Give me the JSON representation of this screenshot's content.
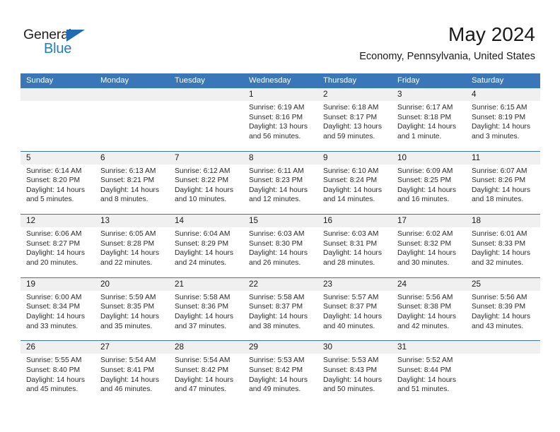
{
  "logo": {
    "word1": "General",
    "word2": "Blue",
    "triangle_color": "#1f6bb4",
    "word2_color": "#1f7ec4"
  },
  "header": {
    "title": "May 2024",
    "subtitle": "Economy, Pennsylvania, United States"
  },
  "theme": {
    "header_bar_color": "#3a77b8",
    "daynum_band_color": "#f0f0f0",
    "text_color": "#1a1a1a"
  },
  "weekdays": [
    "Sunday",
    "Monday",
    "Tuesday",
    "Wednesday",
    "Thursday",
    "Friday",
    "Saturday"
  ],
  "weeks": [
    [
      {
        "day": "",
        "lines": []
      },
      {
        "day": "",
        "lines": []
      },
      {
        "day": "",
        "lines": []
      },
      {
        "day": "1",
        "lines": [
          "Sunrise: 6:19 AM",
          "Sunset: 8:16 PM",
          "Daylight: 13 hours",
          "and 56 minutes."
        ]
      },
      {
        "day": "2",
        "lines": [
          "Sunrise: 6:18 AM",
          "Sunset: 8:17 PM",
          "Daylight: 13 hours",
          "and 59 minutes."
        ]
      },
      {
        "day": "3",
        "lines": [
          "Sunrise: 6:17 AM",
          "Sunset: 8:18 PM",
          "Daylight: 14 hours",
          "and 1 minute."
        ]
      },
      {
        "day": "4",
        "lines": [
          "Sunrise: 6:15 AM",
          "Sunset: 8:19 PM",
          "Daylight: 14 hours",
          "and 3 minutes."
        ]
      }
    ],
    [
      {
        "day": "5",
        "lines": [
          "Sunrise: 6:14 AM",
          "Sunset: 8:20 PM",
          "Daylight: 14 hours",
          "and 5 minutes."
        ]
      },
      {
        "day": "6",
        "lines": [
          "Sunrise: 6:13 AM",
          "Sunset: 8:21 PM",
          "Daylight: 14 hours",
          "and 8 minutes."
        ]
      },
      {
        "day": "7",
        "lines": [
          "Sunrise: 6:12 AM",
          "Sunset: 8:22 PM",
          "Daylight: 14 hours",
          "and 10 minutes."
        ]
      },
      {
        "day": "8",
        "lines": [
          "Sunrise: 6:11 AM",
          "Sunset: 8:23 PM",
          "Daylight: 14 hours",
          "and 12 minutes."
        ]
      },
      {
        "day": "9",
        "lines": [
          "Sunrise: 6:10 AM",
          "Sunset: 8:24 PM",
          "Daylight: 14 hours",
          "and 14 minutes."
        ]
      },
      {
        "day": "10",
        "lines": [
          "Sunrise: 6:09 AM",
          "Sunset: 8:25 PM",
          "Daylight: 14 hours",
          "and 16 minutes."
        ]
      },
      {
        "day": "11",
        "lines": [
          "Sunrise: 6:07 AM",
          "Sunset: 8:26 PM",
          "Daylight: 14 hours",
          "and 18 minutes."
        ]
      }
    ],
    [
      {
        "day": "12",
        "lines": [
          "Sunrise: 6:06 AM",
          "Sunset: 8:27 PM",
          "Daylight: 14 hours",
          "and 20 minutes."
        ]
      },
      {
        "day": "13",
        "lines": [
          "Sunrise: 6:05 AM",
          "Sunset: 8:28 PM",
          "Daylight: 14 hours",
          "and 22 minutes."
        ]
      },
      {
        "day": "14",
        "lines": [
          "Sunrise: 6:04 AM",
          "Sunset: 8:29 PM",
          "Daylight: 14 hours",
          "and 24 minutes."
        ]
      },
      {
        "day": "15",
        "lines": [
          "Sunrise: 6:03 AM",
          "Sunset: 8:30 PM",
          "Daylight: 14 hours",
          "and 26 minutes."
        ]
      },
      {
        "day": "16",
        "lines": [
          "Sunrise: 6:03 AM",
          "Sunset: 8:31 PM",
          "Daylight: 14 hours",
          "and 28 minutes."
        ]
      },
      {
        "day": "17",
        "lines": [
          "Sunrise: 6:02 AM",
          "Sunset: 8:32 PM",
          "Daylight: 14 hours",
          "and 30 minutes."
        ]
      },
      {
        "day": "18",
        "lines": [
          "Sunrise: 6:01 AM",
          "Sunset: 8:33 PM",
          "Daylight: 14 hours",
          "and 32 minutes."
        ]
      }
    ],
    [
      {
        "day": "19",
        "lines": [
          "Sunrise: 6:00 AM",
          "Sunset: 8:34 PM",
          "Daylight: 14 hours",
          "and 33 minutes."
        ]
      },
      {
        "day": "20",
        "lines": [
          "Sunrise: 5:59 AM",
          "Sunset: 8:35 PM",
          "Daylight: 14 hours",
          "and 35 minutes."
        ]
      },
      {
        "day": "21",
        "lines": [
          "Sunrise: 5:58 AM",
          "Sunset: 8:36 PM",
          "Daylight: 14 hours",
          "and 37 minutes."
        ]
      },
      {
        "day": "22",
        "lines": [
          "Sunrise: 5:58 AM",
          "Sunset: 8:37 PM",
          "Daylight: 14 hours",
          "and 38 minutes."
        ]
      },
      {
        "day": "23",
        "lines": [
          "Sunrise: 5:57 AM",
          "Sunset: 8:37 PM",
          "Daylight: 14 hours",
          "and 40 minutes."
        ]
      },
      {
        "day": "24",
        "lines": [
          "Sunrise: 5:56 AM",
          "Sunset: 8:38 PM",
          "Daylight: 14 hours",
          "and 42 minutes."
        ]
      },
      {
        "day": "25",
        "lines": [
          "Sunrise: 5:56 AM",
          "Sunset: 8:39 PM",
          "Daylight: 14 hours",
          "and 43 minutes."
        ]
      }
    ],
    [
      {
        "day": "26",
        "lines": [
          "Sunrise: 5:55 AM",
          "Sunset: 8:40 PM",
          "Daylight: 14 hours",
          "and 45 minutes."
        ]
      },
      {
        "day": "27",
        "lines": [
          "Sunrise: 5:54 AM",
          "Sunset: 8:41 PM",
          "Daylight: 14 hours",
          "and 46 minutes."
        ]
      },
      {
        "day": "28",
        "lines": [
          "Sunrise: 5:54 AM",
          "Sunset: 8:42 PM",
          "Daylight: 14 hours",
          "and 47 minutes."
        ]
      },
      {
        "day": "29",
        "lines": [
          "Sunrise: 5:53 AM",
          "Sunset: 8:42 PM",
          "Daylight: 14 hours",
          "and 49 minutes."
        ]
      },
      {
        "day": "30",
        "lines": [
          "Sunrise: 5:53 AM",
          "Sunset: 8:43 PM",
          "Daylight: 14 hours",
          "and 50 minutes."
        ]
      },
      {
        "day": "31",
        "lines": [
          "Sunrise: 5:52 AM",
          "Sunset: 8:44 PM",
          "Daylight: 14 hours",
          "and 51 minutes."
        ]
      },
      {
        "day": "",
        "lines": []
      }
    ]
  ]
}
